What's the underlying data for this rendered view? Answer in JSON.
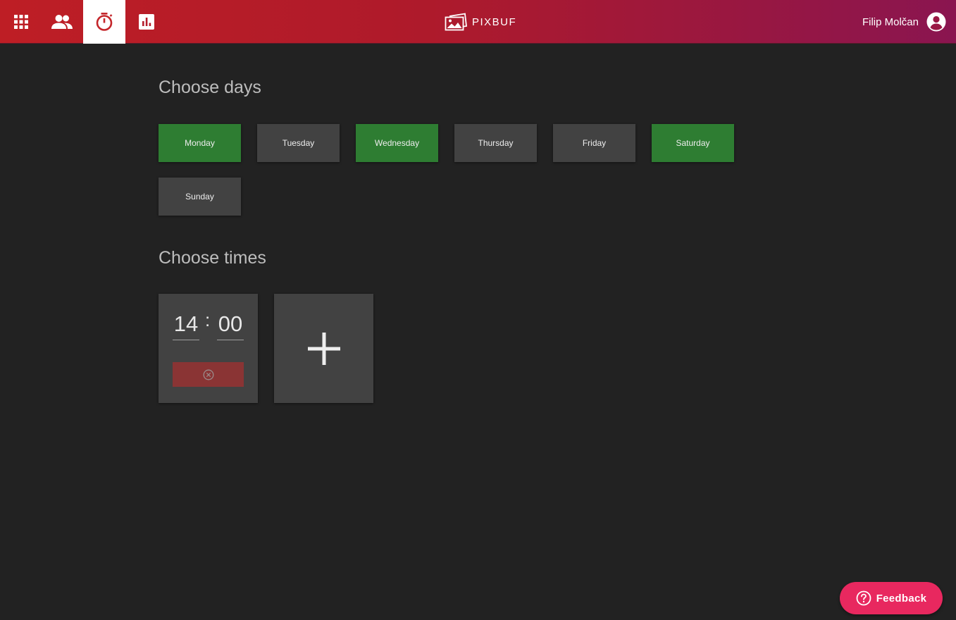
{
  "app": {
    "brand_name": "PIXBUF"
  },
  "nav": {
    "items": [
      {
        "icon": "apps-grid-icon",
        "active": false
      },
      {
        "icon": "people-icon",
        "active": false
      },
      {
        "icon": "timer-icon",
        "active": true
      },
      {
        "icon": "bar-chart-icon",
        "active": false
      }
    ]
  },
  "user": {
    "name": "Filip Molčan",
    "icon": "account-circle-icon"
  },
  "days_section": {
    "title": "Choose days",
    "days": [
      {
        "label": "Monday",
        "selected": true
      },
      {
        "label": "Tuesday",
        "selected": false
      },
      {
        "label": "Wednesday",
        "selected": true
      },
      {
        "label": "Thursday",
        "selected": false
      },
      {
        "label": "Friday",
        "selected": false
      },
      {
        "label": "Saturday",
        "selected": true
      },
      {
        "label": "Sunday",
        "selected": false
      }
    ]
  },
  "times_section": {
    "title": "Choose times",
    "times": [
      {
        "hour": "14",
        "separator": ":",
        "minute": "00"
      }
    ],
    "add_icon": "plus-icon",
    "remove_icon": "close-circle-icon"
  },
  "feedback": {
    "label": "Feedback",
    "icon": "help-circle-icon"
  },
  "colors": {
    "header_start": "#be1e25",
    "header_end": "#8a1550",
    "day_selected": "#2e7d32",
    "day_unselected": "#424242",
    "feedback": "#e8285f",
    "remove": "#8a3434"
  }
}
